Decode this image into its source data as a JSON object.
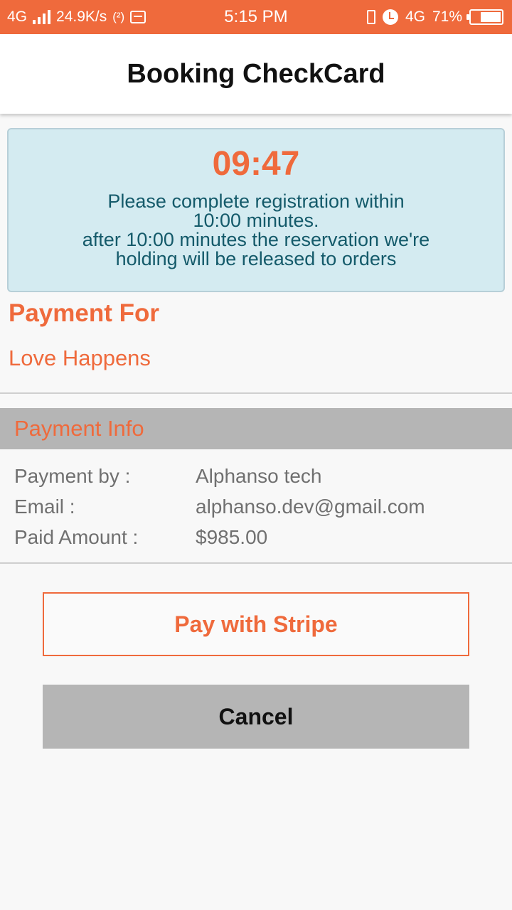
{
  "status_bar": {
    "network": "4G",
    "speed": "24.9K/s",
    "wifi_hotspot": "(²)",
    "time": "5:15 PM",
    "net_right": "4G",
    "battery_percent": "71%",
    "battery_level": 0.71,
    "bg_color": "#ef6a3c"
  },
  "header": {
    "title": "Booking CheckCard"
  },
  "timer_box": {
    "timer": "09:47",
    "line1": "Please complete registration within",
    "line2": "10:00 minutes.",
    "line3": "after 10:00 minutes the reservation we're",
    "line4": "holding will be released to orders"
  },
  "payment_for": {
    "title": "Payment For",
    "movie": "Love Happens"
  },
  "payment_info": {
    "title": "Payment Info",
    "rows": [
      {
        "label": "Payment by :",
        "value": "Alphanso tech"
      },
      {
        "label": "Email :",
        "value": "alphanso.dev@gmail.com"
      },
      {
        "label": "Paid Amount :",
        "value": "$985.00"
      }
    ]
  },
  "buttons": {
    "pay": "Pay with Stripe",
    "cancel": "Cancel"
  },
  "colors": {
    "accent": "#ef6a3c",
    "info_text": "#145a6a",
    "info_bg": "#d4ebf1",
    "gray": "#b5b5b5"
  },
  "icons": [
    "signal-icon",
    "hotspot-icon",
    "notification-icon",
    "vibrate-icon",
    "alarm-icon",
    "battery-icon"
  ]
}
